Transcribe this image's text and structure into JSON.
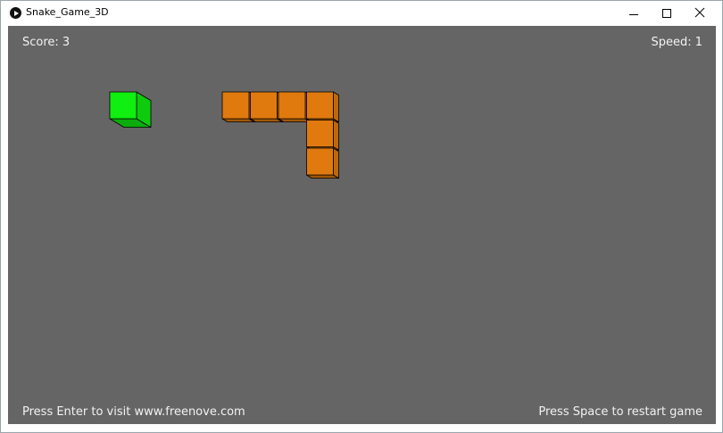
{
  "window": {
    "title": "Snake_Game_3D",
    "icon": "play-circle-icon"
  },
  "hud": {
    "score_text": "Score: 3",
    "speed_text": "Speed: 1",
    "enter_hint": "Press Enter to visit www.freenove.com",
    "space_hint": "Press Space to restart game"
  },
  "colors": {
    "background": "#656565",
    "snake": "#e07a0e",
    "food": "#10ef10"
  },
  "game": {
    "score": 3,
    "speed": 1,
    "food": {
      "col": 0,
      "row": 0
    },
    "snake": [
      {
        "col": 4,
        "row": 0
      },
      {
        "col": 5,
        "row": 0
      },
      {
        "col": 6,
        "row": 0
      },
      {
        "col": 7,
        "row": 0
      },
      {
        "col": 7,
        "row": 1
      },
      {
        "col": 7,
        "row": 2
      }
    ]
  }
}
